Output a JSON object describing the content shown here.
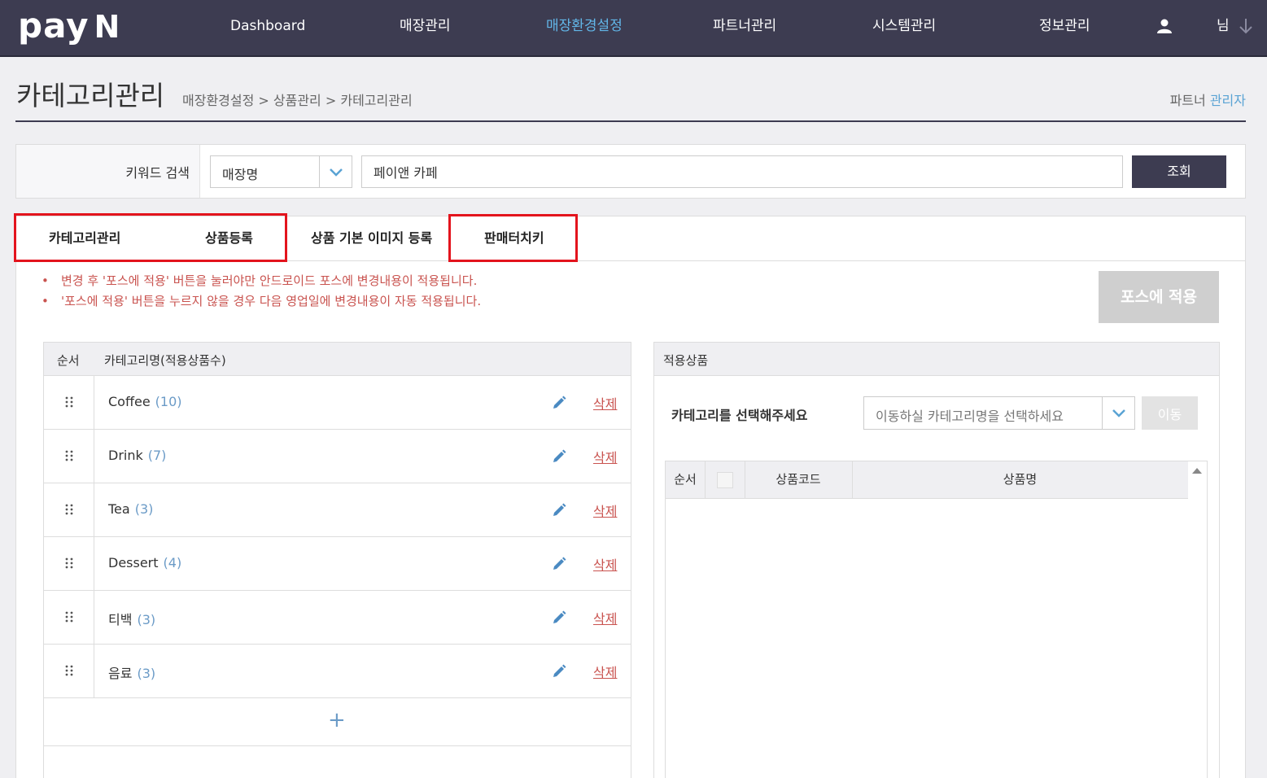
{
  "brand": {
    "logo_main": "pay",
    "logo_n": "N"
  },
  "nav": [
    {
      "label": "Dashboard",
      "active": false
    },
    {
      "label": "매장관리",
      "active": false
    },
    {
      "label": "매장환경설정",
      "active": true
    },
    {
      "label": "파트너관리",
      "active": false
    },
    {
      "label": "시스템관리",
      "active": false
    },
    {
      "label": "정보관리",
      "active": false
    }
  ],
  "user": {
    "name": "님",
    "user_icon": "user-icon",
    "menu_icon": "arrow-down-icon"
  },
  "page": {
    "title": "카테고리관리",
    "breadcrumb": "매장환경설정 > 상품관리 > 카테고리관리",
    "role_prefix": "파트너",
    "role_highlight": "관리자"
  },
  "search": {
    "label": "키워드 검색",
    "select_value": "매장명",
    "input_value": "페이앤 카페",
    "button": "조회"
  },
  "tabs": [
    {
      "label": "카테고리관리"
    },
    {
      "label": "상품등록"
    },
    {
      "label": "상품 기본 이미지 등록"
    },
    {
      "label": "판매터치키"
    }
  ],
  "notices": [
    "변경 후 '포스에 적용' 버튼을 눌러야만 안드로이드 포스에 변경내용이 적용됩니다.",
    "'포스에 적용' 버튼을 누르지 않을 경우 다음 영업일에 변경내용이 자동 적용됩니다."
  ],
  "pos_apply_button": "포스에 적용",
  "category_table": {
    "headers": {
      "order": "순서",
      "name": "카테고리명(적용상품수)"
    },
    "rows": [
      {
        "name": "Coffee",
        "count": "(10)",
        "delete": "삭제"
      },
      {
        "name": "Drink",
        "count": "(7)",
        "delete": "삭제"
      },
      {
        "name": "Tea",
        "count": "(3)",
        "delete": "삭제"
      },
      {
        "name": "Dessert",
        "count": "(4)",
        "delete": "삭제"
      },
      {
        "name": "티백",
        "count": "(3)",
        "delete": "삭제"
      },
      {
        "name": "음료",
        "count": "(3)",
        "delete": "삭제"
      }
    ],
    "add_symbol": "+"
  },
  "applied_products": {
    "title": "적용상품",
    "select_label": "카테고리를 선택해주세요",
    "select_placeholder": "이동하실 카테고리명을 선택하세요",
    "move_button": "이동",
    "headers": {
      "order": "순서",
      "code": "상품코드",
      "name": "상품명"
    }
  },
  "colors": {
    "nav_bg": "#3d3c51",
    "active_nav": "#62b6e8",
    "notice": "#c9534f",
    "highlight_box": "#e3141d"
  }
}
